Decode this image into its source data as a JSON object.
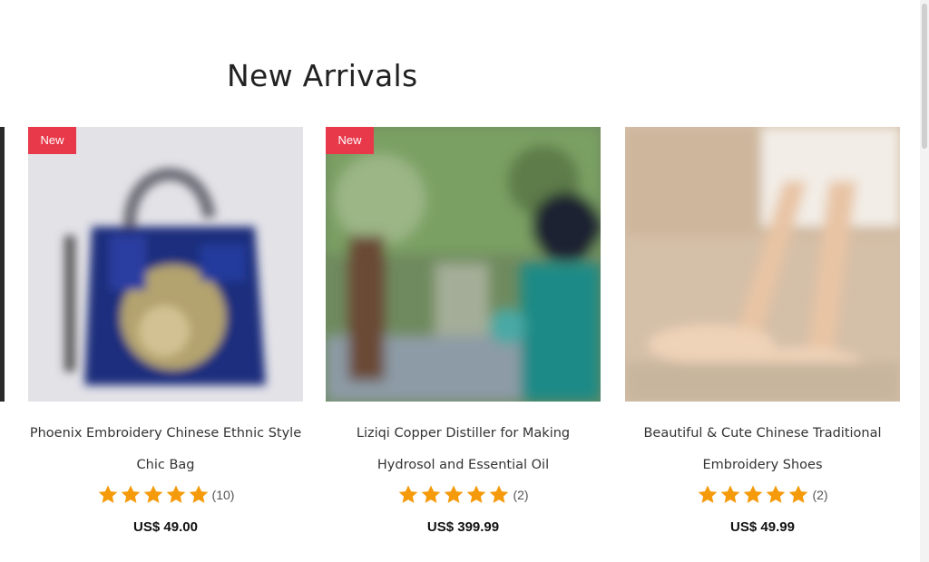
{
  "section": {
    "title": "New Arrivals"
  },
  "products": [
    {
      "badge": "New",
      "title": "Phoenix Embroidery Chinese Ethnic Style Chic Bag",
      "rating_stars": 5,
      "review_count": "(10)",
      "price": "US$ 49.00"
    },
    {
      "badge": "New",
      "title": "Liziqi Copper Distiller for Making Hydrosol and Essential Oil",
      "rating_stars": 5,
      "review_count": "(2)",
      "price": "US$ 399.99"
    },
    {
      "badge": "",
      "title": "Beautiful & Cute Chinese Traditional Embroidery Shoes",
      "rating_stars": 5,
      "review_count": "(2)",
      "price": "US$ 49.99"
    }
  ],
  "colors": {
    "badge": "#e8394a",
    "star": "#f59b0b",
    "price": "#111111"
  },
  "icons": {
    "rating": "star-icon"
  }
}
